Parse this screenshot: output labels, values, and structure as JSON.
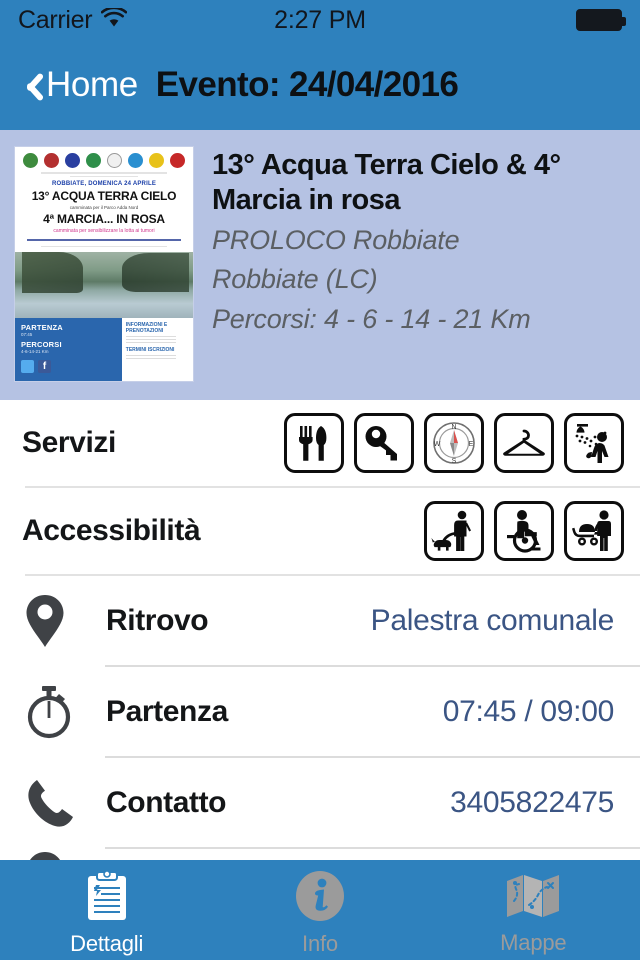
{
  "status_bar": {
    "carrier": "Carrier",
    "wifi_icon": "wifi-icon",
    "time": "2:27 PM",
    "battery_icon": "battery-full-icon"
  },
  "nav_bar": {
    "back_icon": "chevron-left-icon",
    "back_label": "Home",
    "title": "Evento: 24/04/2016",
    "bar_color": "#2e81bd",
    "title_color": "#0d1013"
  },
  "event_card": {
    "background_color": "#b5c2e3",
    "poster": {
      "name": "event-poster-thumbnail",
      "headline_date": "ROBBIATE, DOMENICA 24 APRILE",
      "headline_1": "13° ACQUA TERRA CIELO",
      "sub_1": "camminata per il Parco Adda Nord",
      "headline_2": "4ª MARCIA... IN ROSA",
      "sub_2": "camminata per sensibilizzare la lotta ai tumori",
      "partenza_label": "PARTENZA",
      "partenza_value": "07:45",
      "percorsi_label": "PERCORSI",
      "percorsi_value": "4-6-14-21 Km",
      "info_head": "INFORMAZIONI E PRENOTAZIONI",
      "iscr_head": "TERMINI ISCRIZIONI"
    },
    "title": "13° Acqua Terra Cielo  &  4° Marcia in rosa",
    "organizer": "PROLOCO Robbiate",
    "location": "Robbiate (LC)",
    "routes": "Percorsi: 4 - 6 - 14 - 21 Km"
  },
  "services": {
    "label": "Servizi",
    "icons": [
      {
        "name": "restaurant-icon",
        "title": "Ristoro"
      },
      {
        "name": "key-deposit-icon",
        "title": "Deposito"
      },
      {
        "name": "compass-icon",
        "title": "Orientamento"
      },
      {
        "name": "coat-hanger-icon",
        "title": "Spogliatoio"
      },
      {
        "name": "shower-icon",
        "title": "Docce"
      }
    ]
  },
  "accessibility": {
    "label": "Accessibilità",
    "icons": [
      {
        "name": "dog-friendly-icon",
        "title": "Cani ammessi"
      },
      {
        "name": "wheelchair-icon",
        "title": "Accessibile disabili"
      },
      {
        "name": "stroller-icon",
        "title": "Passeggini"
      }
    ]
  },
  "details": [
    {
      "icon": "map-pin-icon",
      "label": "Ritrovo",
      "value": "Palestra comunale"
    },
    {
      "icon": "stopwatch-icon",
      "label": "Partenza",
      "value": "07:45 / 09:00"
    },
    {
      "icon": "phone-icon",
      "label": "Contatto",
      "value": "3405822475"
    }
  ],
  "detail_value_color": "#3b5584",
  "tab_bar": {
    "background_color": "#2e81bd",
    "active_color": "#ffffff",
    "inactive_color": "#9b9b9b",
    "tabs": [
      {
        "icon": "clipboard-icon",
        "label": "Dettagli",
        "active": true
      },
      {
        "icon": "info-circle-icon",
        "label": "Info",
        "active": false
      },
      {
        "icon": "map-folded-icon",
        "label": "Mappe",
        "active": false
      }
    ]
  }
}
